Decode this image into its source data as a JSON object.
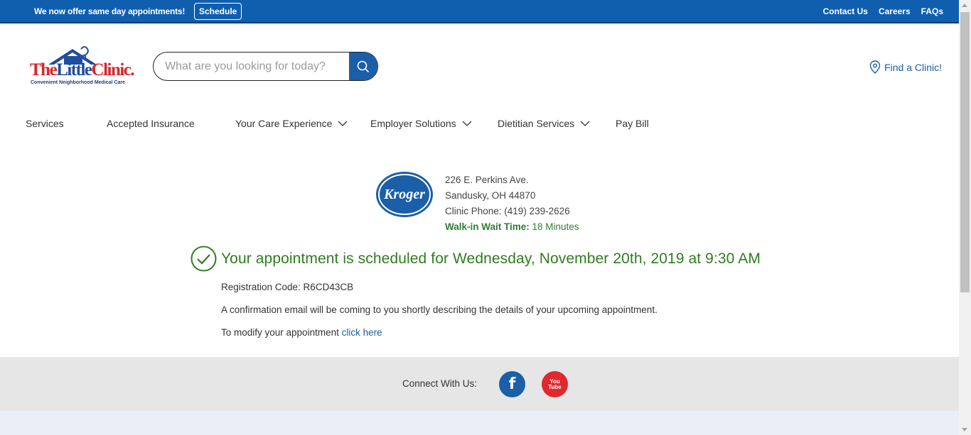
{
  "topbar": {
    "promo": "We now offer same day appointments!",
    "schedule_label": "Schedule",
    "links": [
      "Contact Us",
      "Careers",
      "FAQs"
    ]
  },
  "header": {
    "logo_text_red": "The",
    "logo_text_blue": "Little",
    "logo_text_red2": "Clinic.",
    "logo_tagline": "Convenient Neighborhood Medical Care",
    "search_placeholder": "What are you looking for today?",
    "find_clinic": "Find a Clinic!"
  },
  "nav": {
    "items": [
      "Services",
      "Accepted Insurance",
      "Your Care Experience",
      "Employer Solutions",
      "Dietitian Services",
      "Pay Bill"
    ]
  },
  "clinic": {
    "logo_text": "Kroger",
    "address1": "226 E. Perkins Ave.",
    "address2": "Sandusky, OH 44870",
    "phone": "Clinic Phone: (419) 239-2626",
    "wait_label": "Walk-in Wait Time:",
    "wait_value": "18 Minutes"
  },
  "confirmation": {
    "heading": "Your appointment is scheduled for Wednesday, November 20th, 2019 at 9:30 AM",
    "registration": "Registration Code: R6CD43CB",
    "email_note": "A confirmation email will be coming to you shortly describing the details of your upcoming appointment.",
    "modify_text": "To modify your appointment ",
    "modify_link": "click here"
  },
  "footer": {
    "connect": "Connect With Us:",
    "facebook_glyph": "f",
    "youtube_line1": "You",
    "youtube_line2": "Tube"
  },
  "colors": {
    "brand_blue": "#0f5fae",
    "success_green": "#2f7d1f",
    "youtube_red": "#e0282e"
  }
}
